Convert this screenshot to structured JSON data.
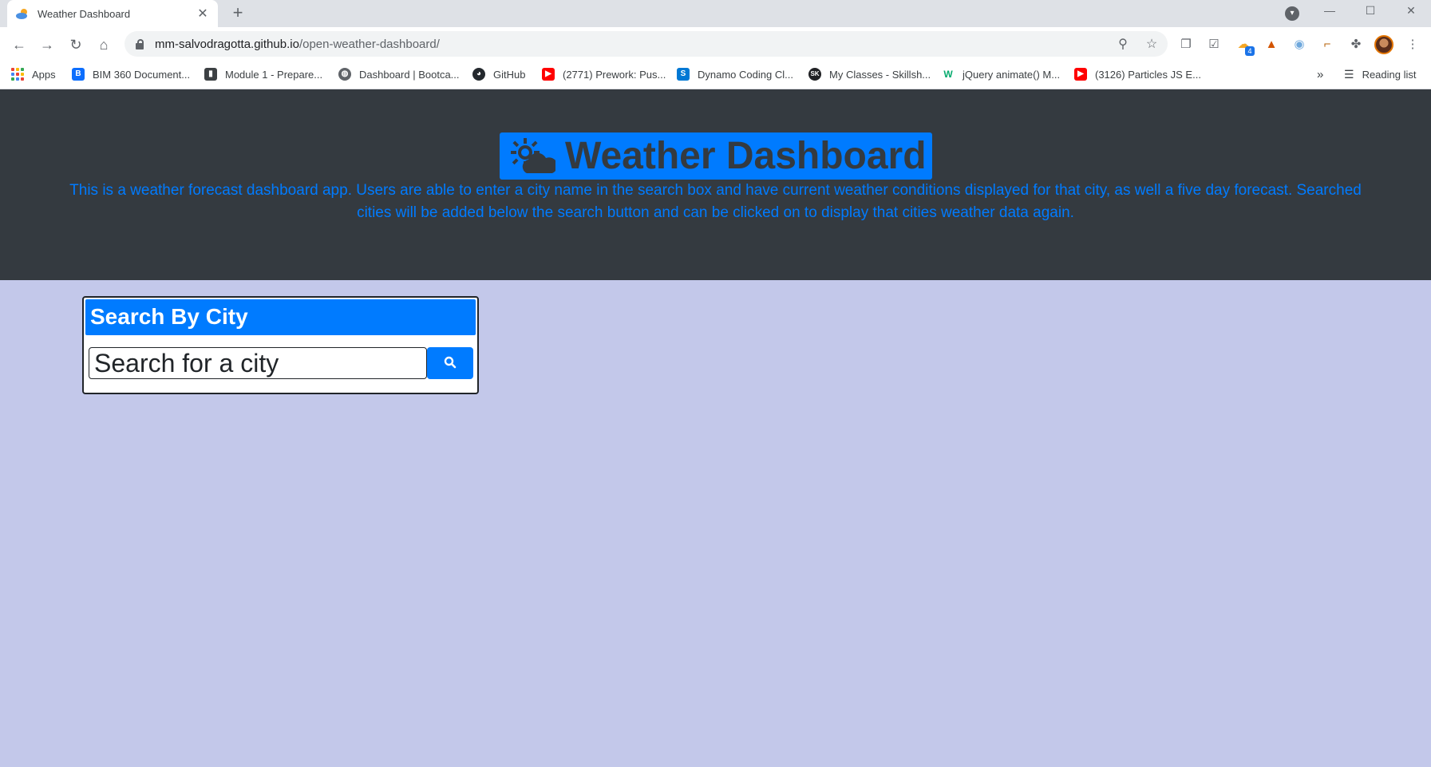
{
  "browser": {
    "tab_title": "Weather Dashboard",
    "tab_close": "✕",
    "new_tab": "+",
    "url_host": "mm-salvodragotta.github.io",
    "url_path": "/open-weather-dashboard/",
    "bookmarks": [
      {
        "label": "Apps"
      },
      {
        "label": "BIM 360 Document..."
      },
      {
        "label": "Module 1 - Prepare..."
      },
      {
        "label": "Dashboard | Bootca..."
      },
      {
        "label": "GitHub"
      },
      {
        "label": "(2771) Prework: Pus..."
      },
      {
        "label": "Dynamo Coding Cl..."
      },
      {
        "label": "My Classes - Skillsh..."
      },
      {
        "label": "jQuery animate() M..."
      },
      {
        "label": "(3126) Particles JS E..."
      }
    ],
    "overflow": "»",
    "reading_list": "Reading list",
    "extension_badge": "4"
  },
  "hero": {
    "title": "Weather Dashboard",
    "description": "This is a weather forecast dashboard app. Users are able to enter a city name in the search box and have current weather conditions displayed for that city, as well a five day forecast. Searched cities will be added below the search button and can be clicked on to display that cities weather data again."
  },
  "search": {
    "header": "Search By City",
    "placeholder": "Search for a city"
  },
  "colors": {
    "primary": "#007bff",
    "hero_bg": "#343a40",
    "page_bg": "#c3c8ea"
  }
}
